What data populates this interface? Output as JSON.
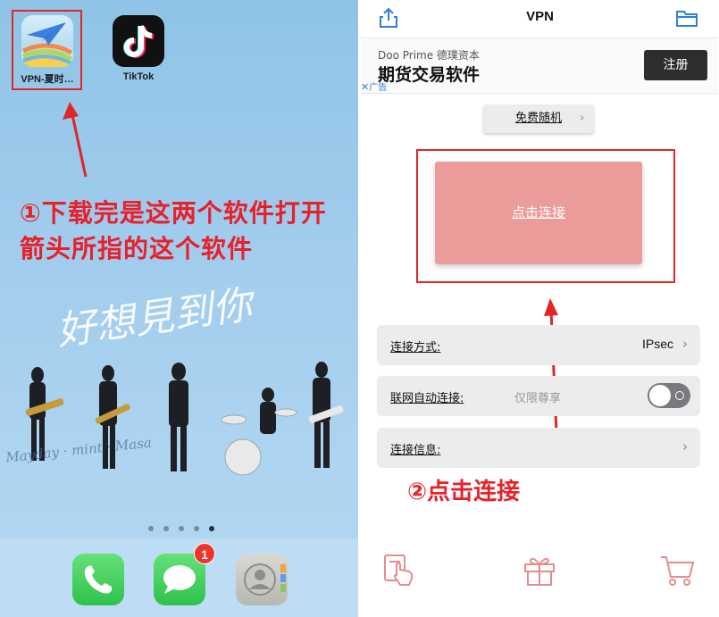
{
  "left_screen": {
    "apps": [
      {
        "label": "VPN-夏时…",
        "icon": "paper-plane-rainbow-icon"
      },
      {
        "label": "TikTok",
        "icon": "tiktok-note-icon"
      }
    ],
    "annotation": "①下载完是这两个软件打开箭头所指的这个软件",
    "page_dots": 5,
    "active_dot": 5,
    "dock": {
      "apps": [
        "phone-icon",
        "messages-icon",
        "contacts-icon"
      ],
      "messages_badge": "1"
    }
  },
  "vpn_app": {
    "nav_title": "VPN",
    "ad": {
      "brand": "Doo Prime 德璞资本",
      "title": "期货交易软件",
      "button": "注册",
      "tag": "广告"
    },
    "free_button": "免费随机",
    "connect_button": "点击连接",
    "rows": [
      {
        "label": "连接方式:",
        "value": "IPsec"
      },
      {
        "label": "联网自动连接:",
        "sub": "仅限尊享"
      },
      {
        "label": "连接信息:"
      }
    ],
    "annotation": "②点击连接",
    "tab_icons": [
      "hand-card-icon",
      "gift-icon",
      "cart-icon"
    ]
  },
  "colors": {
    "annotation_red": "#e0262a",
    "connect_button": "#ec9b9b",
    "tab_icon": "#e58c8c"
  }
}
